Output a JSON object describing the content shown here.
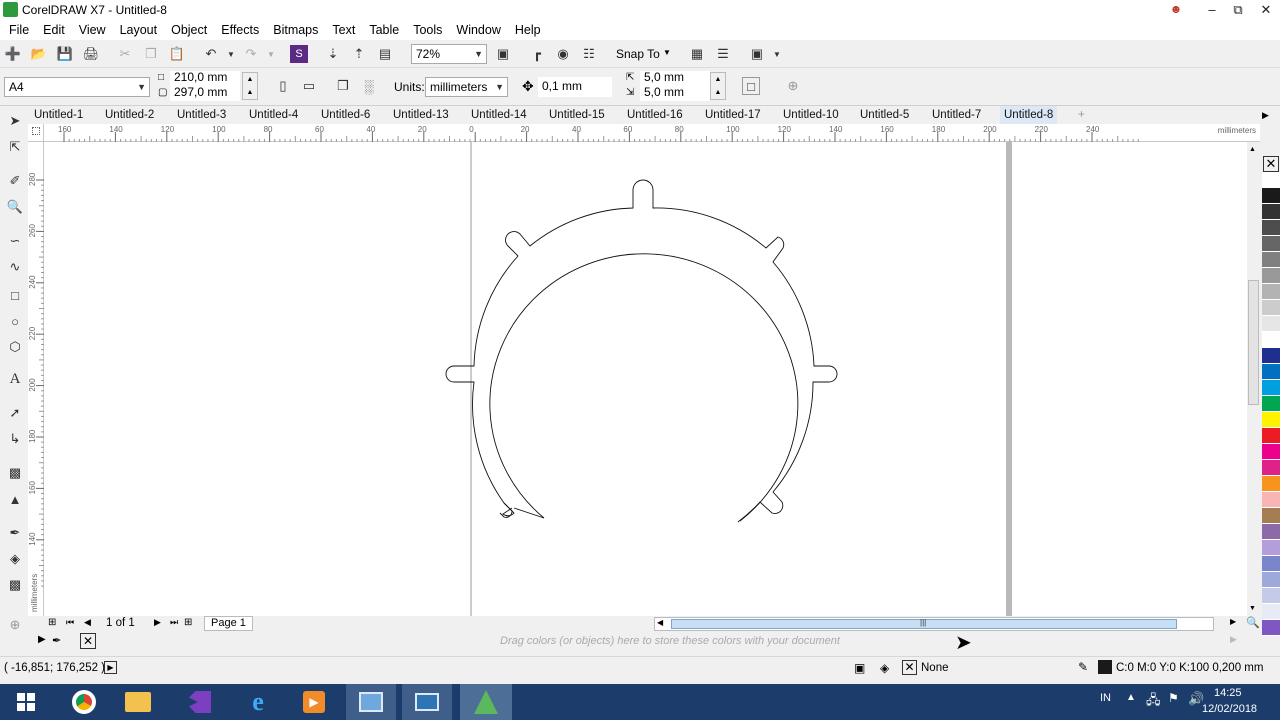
{
  "window": {
    "title": "CorelDRAW X7 - Untitled-8",
    "controls": [
      "minimize",
      "restore",
      "close"
    ]
  },
  "menu": [
    "File",
    "Edit",
    "View",
    "Layout",
    "Object",
    "Effects",
    "Bitmaps",
    "Text",
    "Table",
    "Tools",
    "Window",
    "Help"
  ],
  "toolbar": {
    "zoom": "72%",
    "snap_to": "Snap To"
  },
  "property_bar": {
    "page_size": "A4",
    "width": "210,0 mm",
    "height": "297,0 mm",
    "units_label": "Units:",
    "units": "millimeters",
    "nudge": "0,1 mm",
    "dup_x": "5,0 mm",
    "dup_y": "5,0 mm"
  },
  "tabs": [
    "Untitled-1",
    "Untitled-2",
    "Untitled-3",
    "Untitled-4",
    "Untitled-6",
    "Untitled-13",
    "Untitled-14",
    "Untitled-15",
    "Untitled-16",
    "Untitled-17",
    "Untitled-10",
    "Untitled-5",
    "Untitled-7",
    "Untitled-8"
  ],
  "active_tab": "Untitled-8",
  "ruler": {
    "h_labels": [
      "160",
      "140",
      "120",
      "100",
      "80",
      "60",
      "40",
      "20",
      "0",
      "20",
      "40",
      "60",
      "80",
      "100",
      "120",
      "140",
      "160",
      "180",
      "200",
      "220",
      "240"
    ],
    "units": "millimeters",
    "v_labels": [
      "280",
      "260",
      "240",
      "220",
      "200",
      "180",
      "160",
      "140"
    ]
  },
  "pager": {
    "count": "1 of 1",
    "page_tab": "Page 1"
  },
  "document_palette_hint": "Drag colors (or objects) here to store these colors with your document",
  "status": {
    "coords": "( -16,851; 176,252 )",
    "fill": "None",
    "outline": "C:0 M:0 Y:0 K:100  0,200 mm"
  },
  "taskbar": {
    "lang": "IN",
    "time": "14:25",
    "date": "12/02/2018"
  },
  "palette_colors": [
    "#ffffff",
    "#1a1a1a",
    "#333333",
    "#4d4d4d",
    "#666666",
    "#808080",
    "#999999",
    "#b3b3b3",
    "#cccccc",
    "#e6e6e6",
    "#ffffff",
    "#1f2f8f",
    "#0070c0",
    "#00a0e0",
    "#00a651",
    "#fff200",
    "#ed1c24",
    "#ec008c",
    "#e0218a",
    "#f7941d",
    "#f9b5b5",
    "#a67c52",
    "#8c6aa8",
    "#b39ddb",
    "#7986cb",
    "#9fa8da",
    "#c5cae9",
    "#e8eaf6",
    "#7e57c2"
  ]
}
